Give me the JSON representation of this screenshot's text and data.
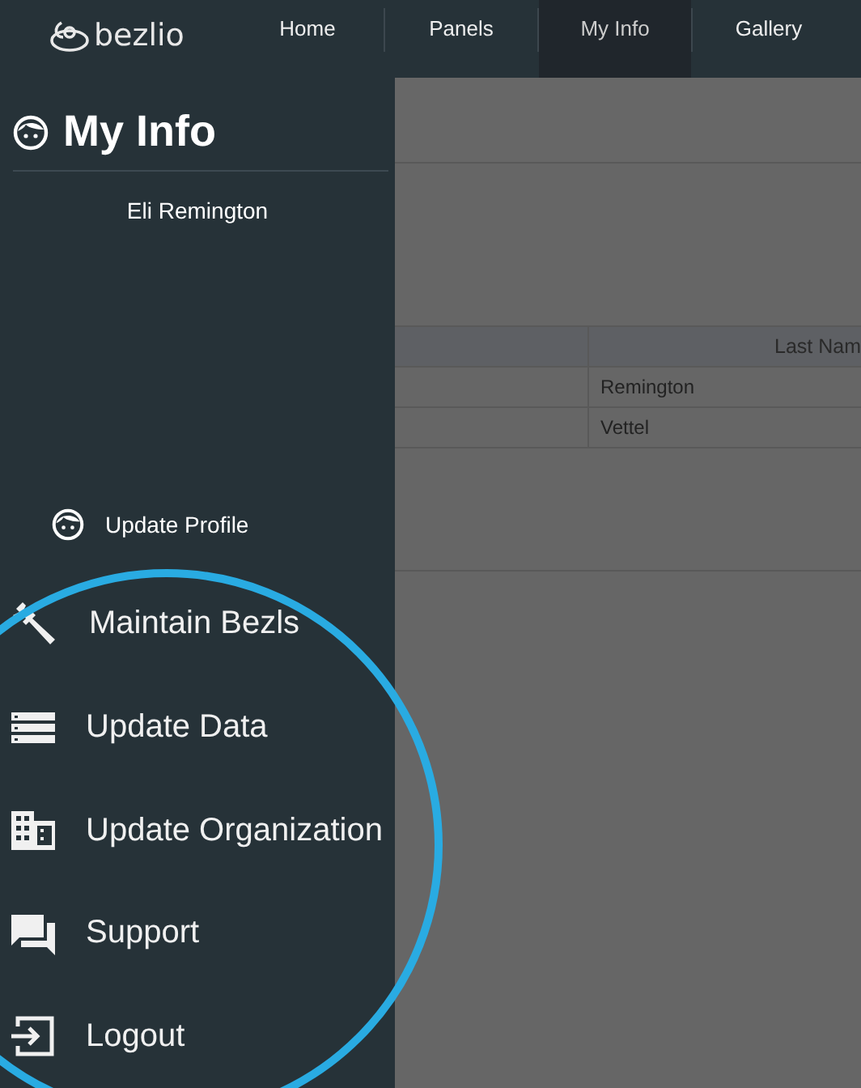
{
  "nav": {
    "logo": "bezlio",
    "tabs": [
      {
        "label": "Home",
        "selected": false
      },
      {
        "label": "Panels",
        "selected": false
      },
      {
        "label": "My Info",
        "selected": true
      },
      {
        "label": "Gallery",
        "selected": false
      }
    ]
  },
  "sidebar": {
    "title": "My Info",
    "user_name": "Eli Remington",
    "profile_link": "Update Profile",
    "menu": [
      {
        "label": "Maintain Bezls"
      },
      {
        "label": "Update Data"
      },
      {
        "label": "Update Organization"
      },
      {
        "label": "Support"
      },
      {
        "label": "Logout"
      }
    ]
  },
  "table": {
    "column_2": {
      "header": "Last Nam",
      "cells": [
        "Remington",
        "Vettel"
      ]
    }
  }
}
